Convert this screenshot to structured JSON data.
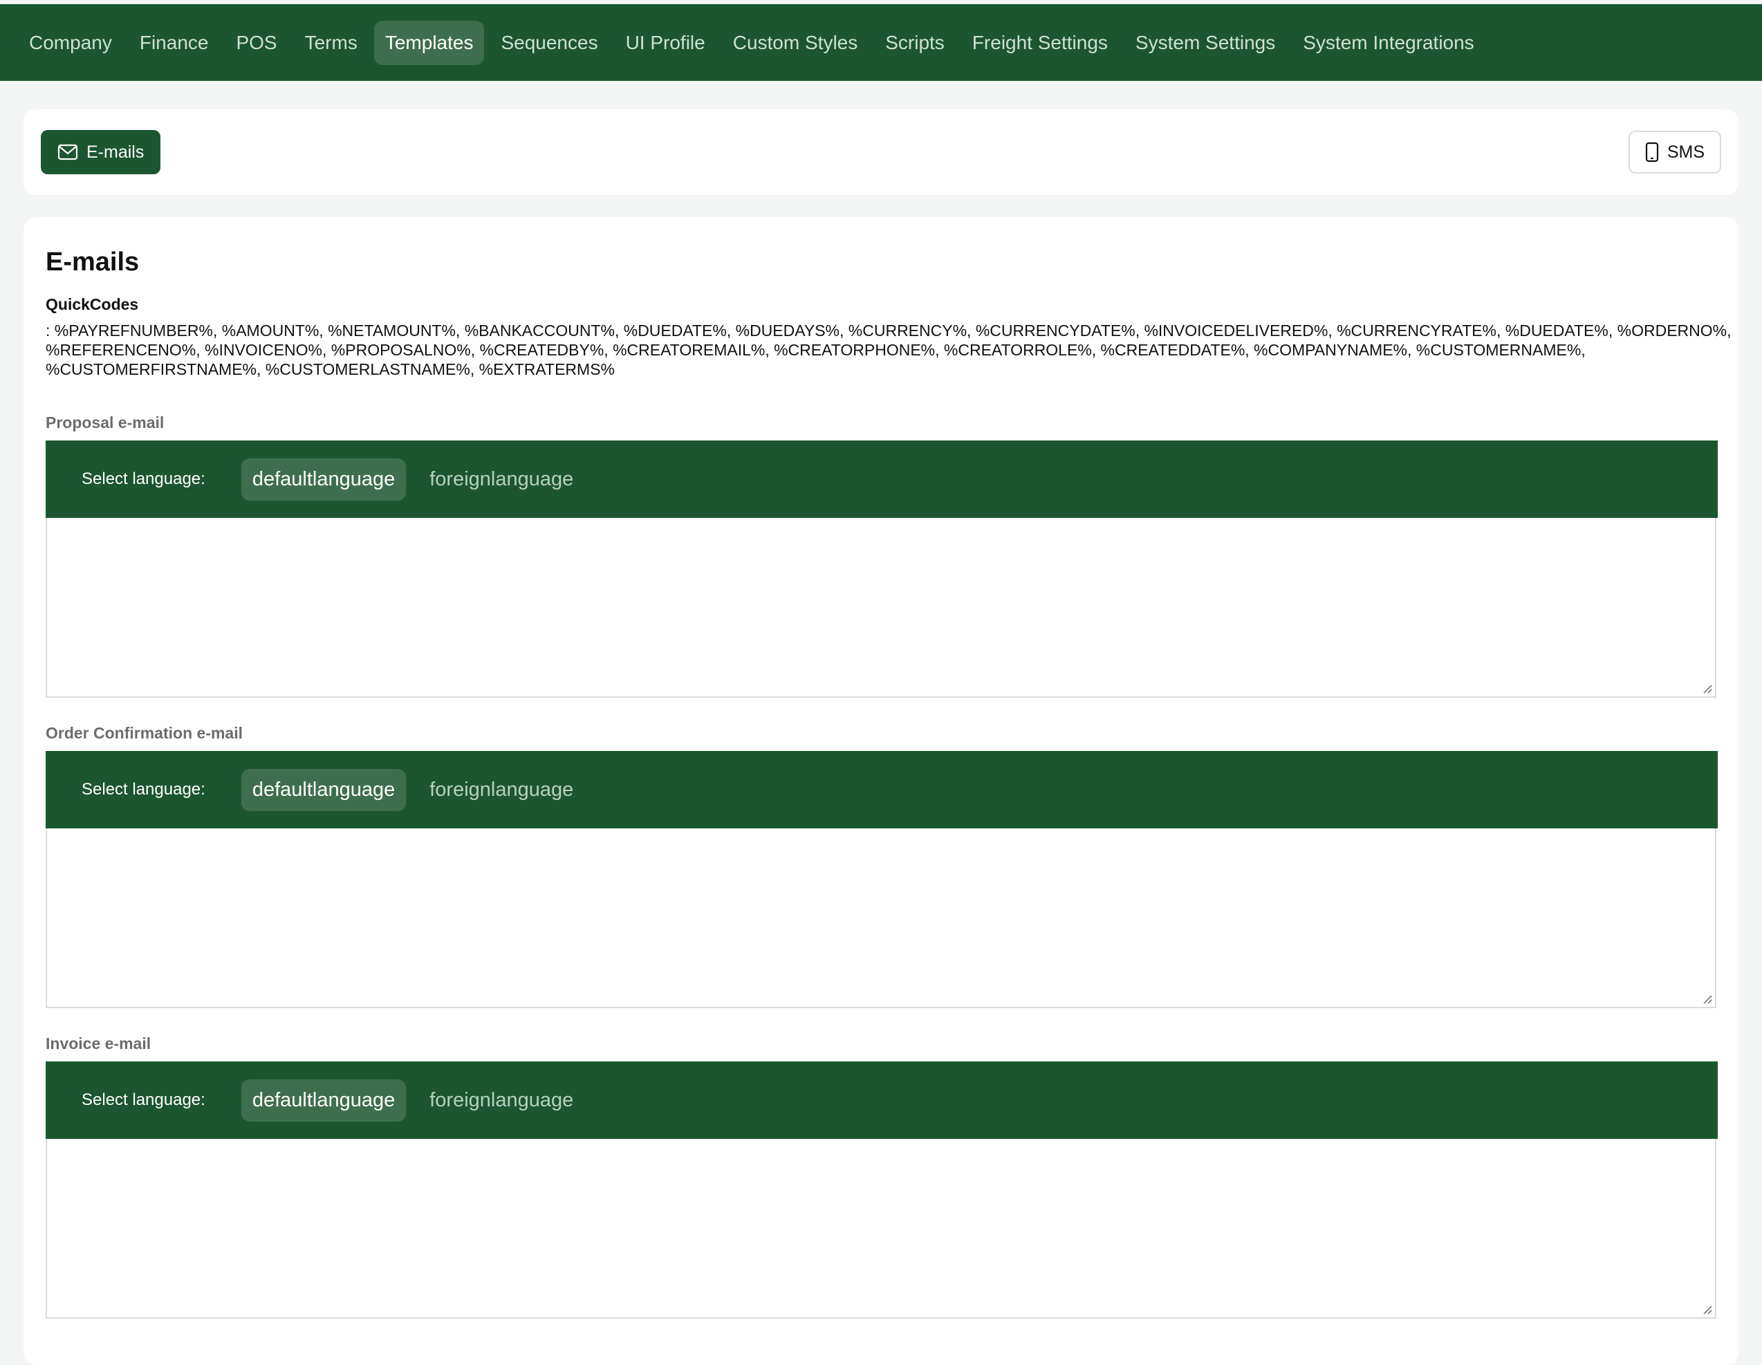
{
  "nav": {
    "tabs": [
      {
        "label": "Company"
      },
      {
        "label": "Finance"
      },
      {
        "label": "POS"
      },
      {
        "label": "Terms"
      },
      {
        "label": "Templates",
        "active": true
      },
      {
        "label": "Sequences"
      },
      {
        "label": "UI Profile"
      },
      {
        "label": "Custom Styles"
      },
      {
        "label": "Scripts"
      },
      {
        "label": "Freight Settings"
      },
      {
        "label": "System Settings"
      },
      {
        "label": "System Integrations"
      }
    ]
  },
  "toolbar": {
    "emails_label": "E-mails",
    "sms_label": "SMS"
  },
  "main": {
    "title": "E-mails",
    "quickcodes_title": "QuickCodes",
    "quickcodes_text": ": %PAYREFNUMBER%, %AMOUNT%, %NETAMOUNT%, %BANKACCOUNT%, %DUEDATE%, %DUEDAYS%, %CURRENCY%, %CURRENCYDATE%, %INVOICEDELIVERED%, %CURRENCYRATE%, %DUEDATE%, %ORDERNO%, %REFERENCENO%, %INVOICENO%, %PROPOSALNO%, %CREATEDBY%, %CREATOREMAIL%, %CREATORPHONE%, %CREATORROLE%, %CREATEDDATE%, %COMPANYNAME%, %CUSTOMERNAME%, %CUSTOMERFIRSTNAME%, %CUSTOMERLASTNAME%, %EXTRATERMS%",
    "sections": [
      {
        "label": "Proposal e-mail",
        "lang_label": "Select language:",
        "lang_default": "defaultlanguage",
        "lang_foreign": "foreignlanguage"
      },
      {
        "label": "Order Confirmation e-mail",
        "lang_label": "Select language:",
        "lang_default": "defaultlanguage",
        "lang_foreign": "foreignlanguage"
      },
      {
        "label": "Invoice e-mail",
        "lang_label": "Select language:",
        "lang_default": "defaultlanguage",
        "lang_foreign": "foreignlanguage"
      }
    ]
  },
  "colors": {
    "brand": "#1b5631",
    "active_tab": "#3d6f4e"
  }
}
